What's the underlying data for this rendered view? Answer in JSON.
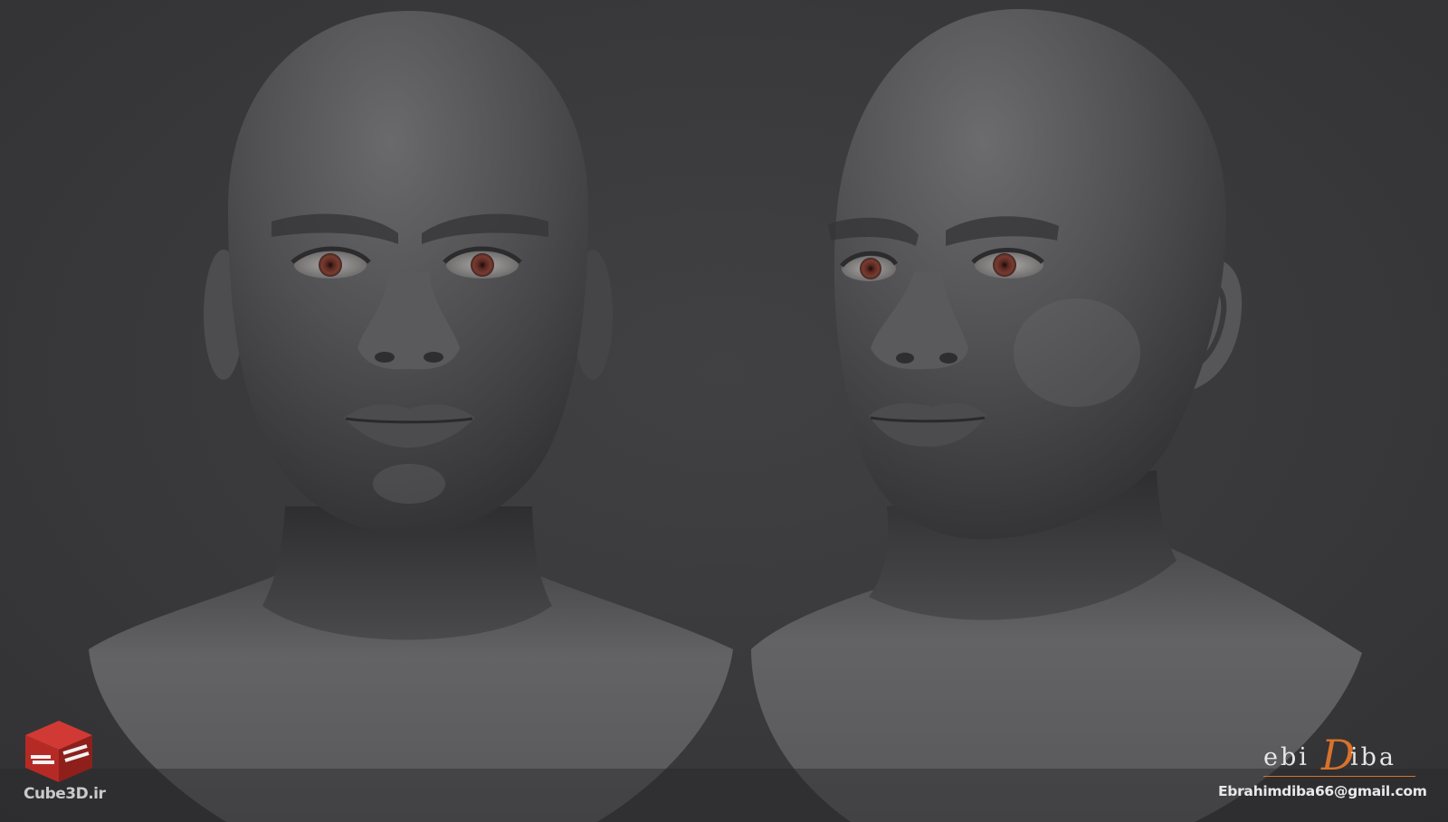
{
  "watermark_left": {
    "logo_icon": "red-cube-logo-icon",
    "brand_color": "#b62a25",
    "site": "Cube3D.ir"
  },
  "watermark_right": {
    "signature_prefix": "ebi",
    "signature_initial": "D",
    "signature_suffix": "iba",
    "accent_color": "#d9722a",
    "email": "Ebrahimdiba66@gmail.com"
  },
  "renders": [
    {
      "view": "front-view",
      "eye_color": "#6e3328"
    },
    {
      "view": "three-quarter-view",
      "eye_color": "#6e3328"
    }
  ]
}
